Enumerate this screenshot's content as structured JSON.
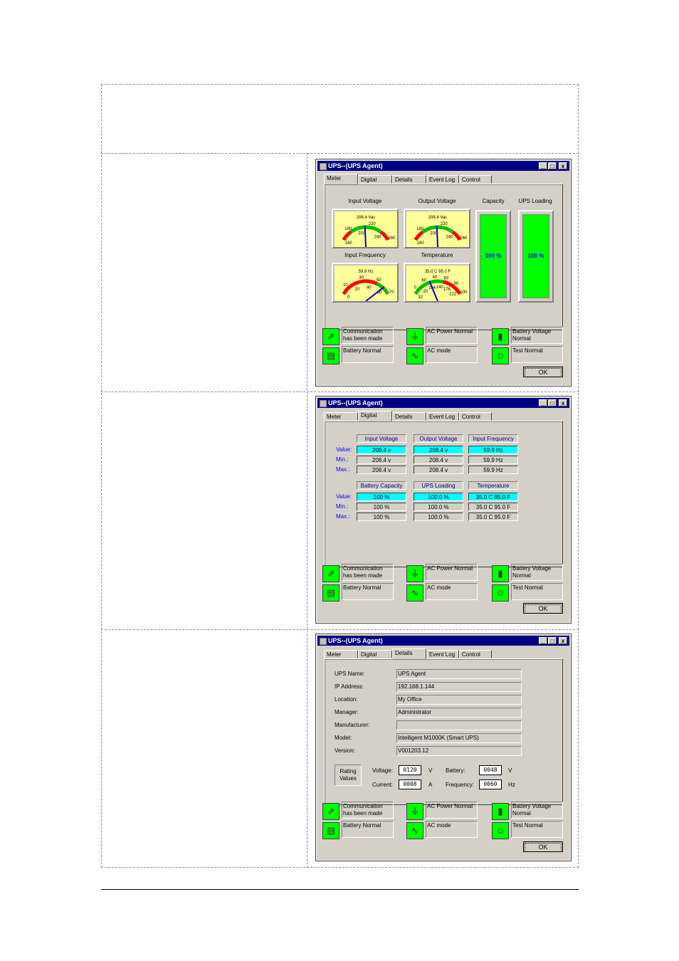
{
  "window_title": "UPS--(UPS Agent)",
  "window_buttons": {
    "minimize": "_",
    "maximize": "□",
    "close": "x"
  },
  "tabs": [
    "Meter",
    "Digital",
    "Details",
    "Event Log",
    "Control"
  ],
  "ok_label": "OK",
  "status": [
    {
      "text": "Communication has been made",
      "icon": "network-cable-icon"
    },
    {
      "text": "AC Power Normal",
      "icon": "power-plug-icon"
    },
    {
      "text": "Battery Voltage Normal",
      "icon": "battery-icon"
    },
    {
      "text": "Battery Normal",
      "icon": "battery-pack-icon"
    },
    {
      "text": "AC mode",
      "icon": "sine-wave-icon"
    },
    {
      "text": "Test Normal",
      "icon": "test-person-icon"
    }
  ],
  "meter": {
    "input_voltage": {
      "label": "Input Voltage",
      "reading": "208.4 Vac",
      "ticks": [
        "160",
        "180",
        "200",
        "220",
        "240",
        "260"
      ],
      "value": 208.4
    },
    "output_voltage": {
      "label": "Output Voltage",
      "reading": "208.4 Vac",
      "ticks": [
        "160",
        "180",
        "200",
        "220",
        "240",
        "260"
      ],
      "value": 208.4
    },
    "input_frequency": {
      "label": "Input Frequency",
      "reading": "59.9 Hz",
      "ticks": [
        "0",
        "10",
        "20",
        "30",
        "40",
        "50",
        "60",
        "70"
      ],
      "value": 59.9
    },
    "temperature": {
      "label": "Temperature",
      "reading": "35.0 C  95.0 F",
      "ticks": [
        "32",
        "0",
        "20",
        "60",
        "104",
        "40",
        "140",
        "60",
        "176",
        "80",
        "212",
        "100"
      ],
      "value": 35.0
    },
    "capacity": {
      "label": "Capacity",
      "text": "100 %",
      "percent": 100
    },
    "ups_loading": {
      "label": "UPS Loading",
      "text": "100 %",
      "percent": 100
    }
  },
  "digital": {
    "row_labels": [
      "Value:",
      "Min.:",
      "Max.:"
    ],
    "group1": {
      "headers": [
        "Input Voltage",
        "Output Voltage",
        "Input Frequency"
      ],
      "rows": [
        [
          "208.4 v",
          "208.4 v",
          "59.9 Hz"
        ],
        [
          "208.4 v",
          "208.4 v",
          "59.9 Hz"
        ],
        [
          "208.4 v",
          "208.4 v",
          "59.9 Hz"
        ]
      ]
    },
    "group2": {
      "headers": [
        "Battery Capacity",
        "UPS Loading",
        "Temperature"
      ],
      "rows": [
        [
          "100 %",
          "100.0 %",
          "35.0 C  95.0 F"
        ],
        [
          "100 %",
          "100.0 %",
          "35.0 C  95.0 F"
        ],
        [
          "100 %",
          "100.0 %",
          "35.0 C  95.0 F"
        ]
      ]
    }
  },
  "details": {
    "fields": [
      {
        "label": "UPS Name:",
        "value": "UPS Agent"
      },
      {
        "label": "IP Address:",
        "value": "192.168.1.144"
      },
      {
        "label": "Location:",
        "value": "My Office"
      },
      {
        "label": "Manager:",
        "value": "Administrator"
      },
      {
        "label": "Manufacturer:",
        "value": ""
      },
      {
        "label": "Model:",
        "value": "Intelligent M1000K    (Smart UPS)"
      },
      {
        "label": "Version:",
        "value": "V001203.12"
      }
    ],
    "rating_title": "Rating Values",
    "voltage": {
      "label": "Voltage:",
      "value": "0120",
      "unit": "V"
    },
    "battery": {
      "label": "Battery:",
      "value": "0048",
      "unit": "V"
    },
    "current": {
      "label": "Current:",
      "value": "0008",
      "unit": "A"
    },
    "frequency": {
      "label": "Frequency:",
      "value": "0060",
      "unit": "Hz"
    }
  },
  "colors": {
    "titlebar": "#000080",
    "status_green": "#00ff00",
    "value_cyan": "#00ffff",
    "label_blue": "#0000ff"
  }
}
